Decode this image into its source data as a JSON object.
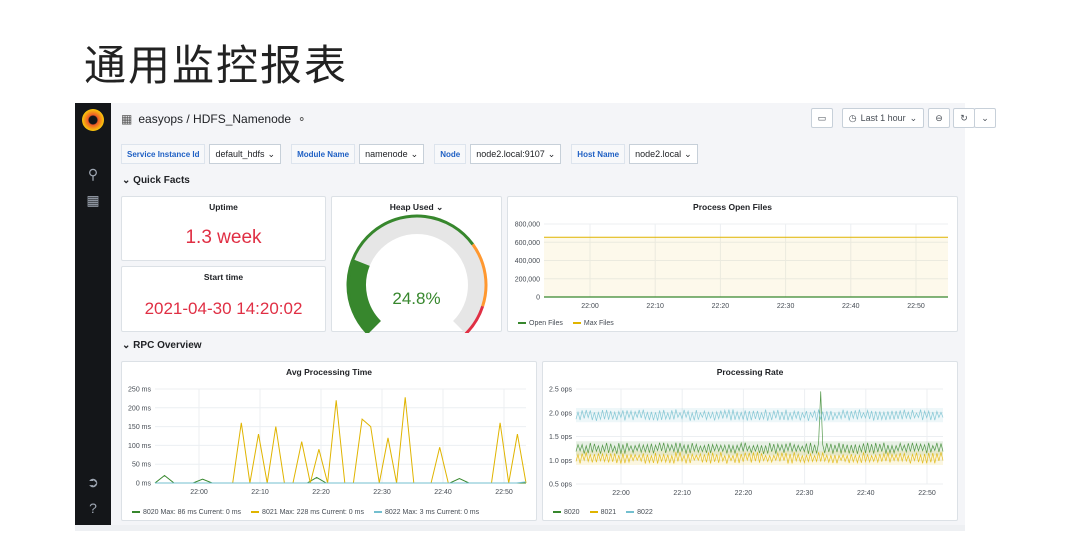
{
  "slide": {
    "title": "通用监控报表"
  },
  "header": {
    "breadcrumb": "easyops / HDFS_Namenode",
    "time_range": "Last 1 hour"
  },
  "variables": [
    {
      "label": "Service Instance Id",
      "value": "default_hdfs"
    },
    {
      "label": "Module Name",
      "value": "namenode"
    },
    {
      "label": "Node",
      "value": "node2.local:9107"
    },
    {
      "label": "Host Name",
      "value": "node2.local"
    }
  ],
  "rows": {
    "quick_facts": "Quick Facts",
    "rpc_overview": "RPC Overview"
  },
  "panels": {
    "uptime": {
      "title": "Uptime",
      "value": "1.3 week"
    },
    "start_time": {
      "title": "Start time",
      "value": "2021-04-30 14:20:02"
    },
    "heap": {
      "title": "Heap Used",
      "value": "24.8%",
      "fraction": 0.248
    },
    "open_files": {
      "title": "Process Open Files",
      "legend": [
        "Open Files",
        "Max Files"
      ]
    },
    "avg_time": {
      "title": "Avg Processing Time",
      "legend": [
        "8020  Max: 86 ms  Current: 0 ms",
        "8021  Max: 228 ms  Current: 0 ms",
        "8022  Max: 3 ms  Current: 0 ms"
      ]
    },
    "rate": {
      "title": "Processing Rate",
      "legend": [
        "8020",
        "8021",
        "8022"
      ]
    }
  },
  "colors": {
    "green": "#37872d",
    "yellow": "#e0b400",
    "cyan": "#73bfcf",
    "red": "#e02f44",
    "orange": "#ff9830"
  },
  "chart_data": [
    {
      "type": "line",
      "title": "Process Open Files",
      "x": [
        "22:00",
        "22:10",
        "22:20",
        "22:30",
        "22:40",
        "22:50"
      ],
      "ylim": [
        0,
        800000
      ],
      "yticks": [
        "800,000",
        "600,000",
        "400,000",
        "200,000",
        "0"
      ],
      "series": [
        {
          "name": "Open Files",
          "values": [
            0,
            0,
            0,
            0,
            0,
            0
          ]
        },
        {
          "name": "Max Files",
          "values": [
            655360,
            655360,
            655360,
            655360,
            655360,
            655360
          ]
        }
      ]
    },
    {
      "type": "line",
      "title": "Avg Processing Time",
      "x": [
        "22:00",
        "22:10",
        "22:20",
        "22:30",
        "22:40",
        "22:50"
      ],
      "ylim": [
        0,
        250
      ],
      "yticks": [
        "250 ms",
        "200 ms",
        "150 ms",
        "100 ms",
        "50 ms",
        "0 ms"
      ],
      "series": [
        {
          "name": "8020",
          "values": [
            0,
            20,
            0,
            0,
            0,
            10,
            0,
            0,
            0,
            0,
            0,
            0,
            0,
            0,
            0,
            0,
            0,
            15,
            0,
            0,
            0,
            0,
            0,
            0,
            0,
            0,
            0,
            0,
            0,
            0,
            0,
            0,
            12,
            0,
            0,
            0,
            0,
            0,
            0,
            0
          ]
        },
        {
          "name": "8021",
          "values": [
            0,
            0,
            0,
            0,
            0,
            0,
            0,
            0,
            0,
            0,
            160,
            0,
            130,
            0,
            150,
            0,
            0,
            110,
            0,
            90,
            0,
            220,
            0,
            0,
            170,
            150,
            0,
            120,
            0,
            228,
            0,
            0,
            0,
            95,
            0,
            0,
            0,
            0,
            0,
            0,
            160,
            0,
            130,
            0
          ]
        },
        {
          "name": "8022",
          "values": [
            0,
            0,
            0,
            0,
            0,
            0,
            0,
            0,
            0,
            0,
            0,
            0,
            0,
            0,
            0,
            0,
            0,
            0,
            0,
            0,
            0,
            0,
            0,
            0,
            0,
            0,
            0,
            0,
            0,
            0,
            0,
            0,
            0,
            0,
            0,
            0,
            0,
            0,
            0,
            3
          ]
        }
      ]
    },
    {
      "type": "line",
      "title": "Processing Rate",
      "x": [
        "22:00",
        "22:10",
        "22:20",
        "22:30",
        "22:40",
        "22:50"
      ],
      "ylim": [
        0.5,
        2.5
      ],
      "yticks": [
        "2.5 ops",
        "2.0 ops",
        "1.5 ops",
        "1.0 ops",
        "0.5 ops"
      ],
      "series": [
        {
          "name": "8020",
          "values": [
            1.1,
            1.4
          ]
        },
        {
          "name": "8021",
          "values": [
            0.9,
            1.2
          ]
        },
        {
          "name": "8022",
          "values": [
            1.8,
            2.1
          ]
        }
      ]
    }
  ]
}
